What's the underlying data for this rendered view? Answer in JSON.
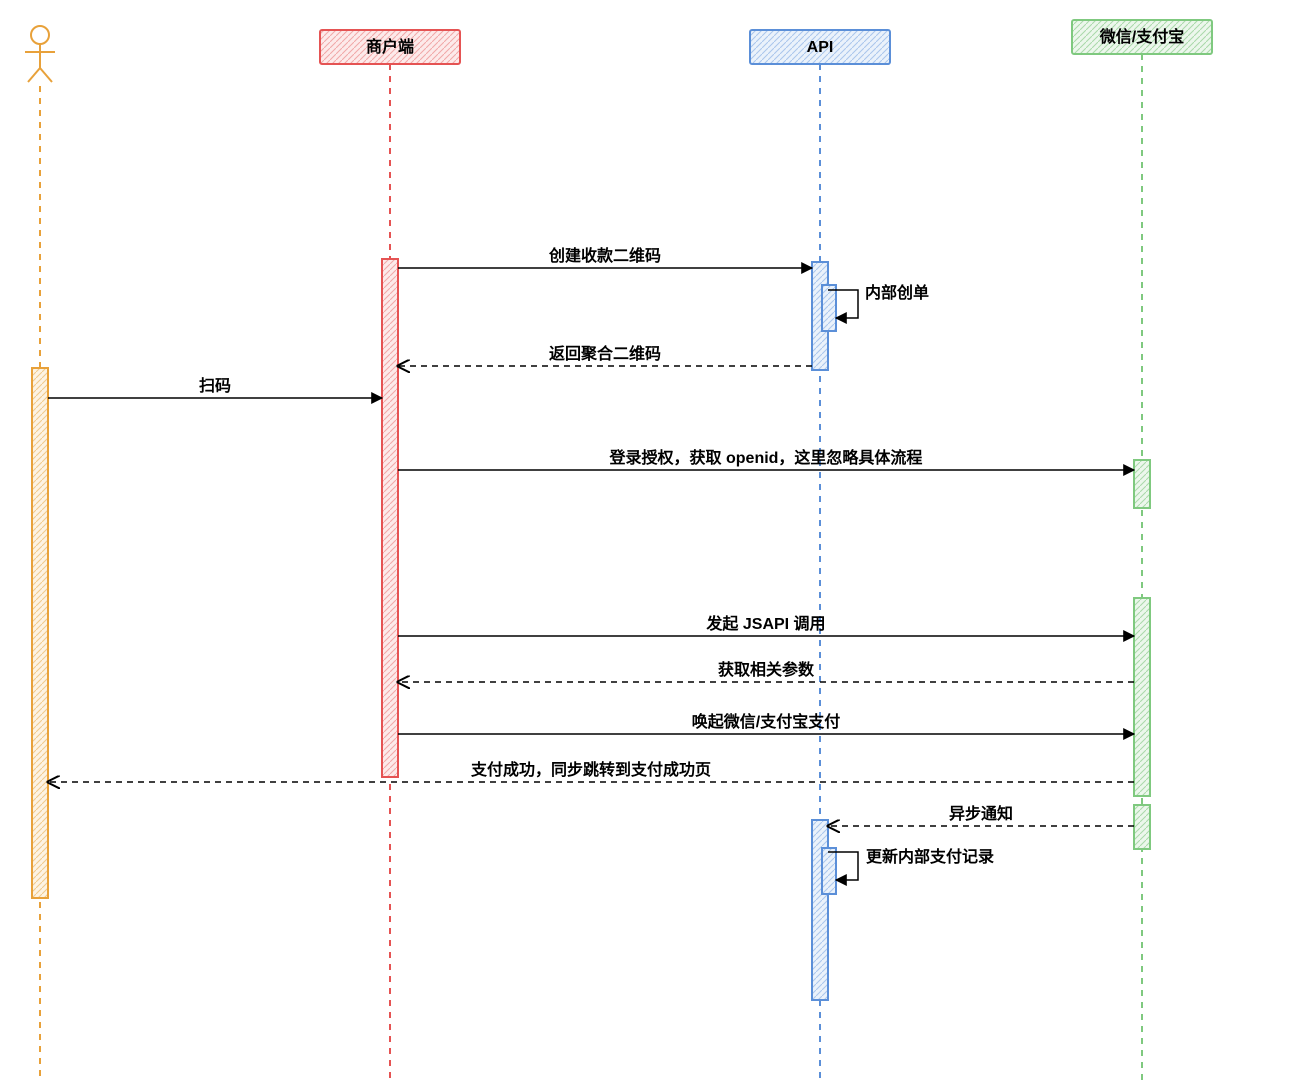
{
  "diagram": {
    "type": "sequence",
    "participants": {
      "user": {
        "label": "",
        "kind": "actor",
        "color": "#e8a13a"
      },
      "merchant": {
        "label": "商户端",
        "color": "#e55353"
      },
      "api": {
        "label": "API",
        "color": "#5b8fd8"
      },
      "wxali": {
        "label": "微信/支付宝",
        "color": "#7fc97f"
      }
    },
    "messages": {
      "m1": "创建收款二维码",
      "m2": "内部创单",
      "m3": "返回聚合二维码",
      "m4": "扫码",
      "m5": "登录授权，获取 openid，这里忽略具体流程",
      "m6": "发起 JSAPI 调用",
      "m7": "获取相关参数",
      "m8": "唤起微信/支付宝支付",
      "m9": "支付成功，同步跳转到支付成功页",
      "m10": "异步通知",
      "m11": "更新内部支付记录"
    }
  }
}
